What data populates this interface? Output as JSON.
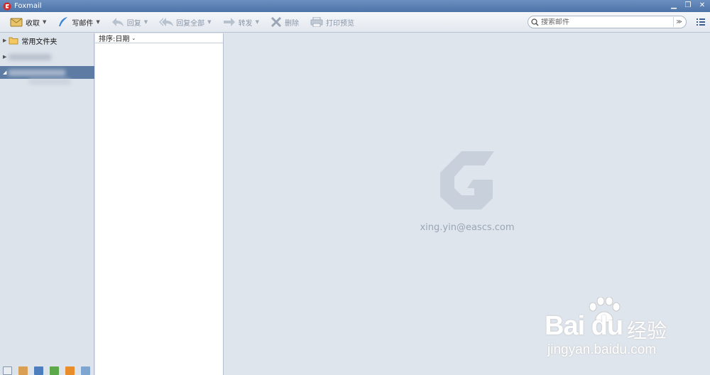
{
  "window": {
    "title": "Foxmail",
    "accent": "#4d74a9"
  },
  "toolbar": {
    "receive": "收取",
    "compose": "写邮件",
    "reply": "回复",
    "reply_all": "回复全部",
    "forward": "转发",
    "delete": "删除",
    "print_preview": "打印预览"
  },
  "search": {
    "placeholder": "搜索邮件",
    "value": ""
  },
  "sidebar": {
    "favorites_label": "常用文件夹"
  },
  "list": {
    "sort_label": "排序:日期"
  },
  "reading": {
    "account": "xing.yin@eascs.com"
  },
  "watermark": {
    "brand": "Bai du",
    "cn": "经验",
    "url": "jingyan.baidu.com"
  }
}
